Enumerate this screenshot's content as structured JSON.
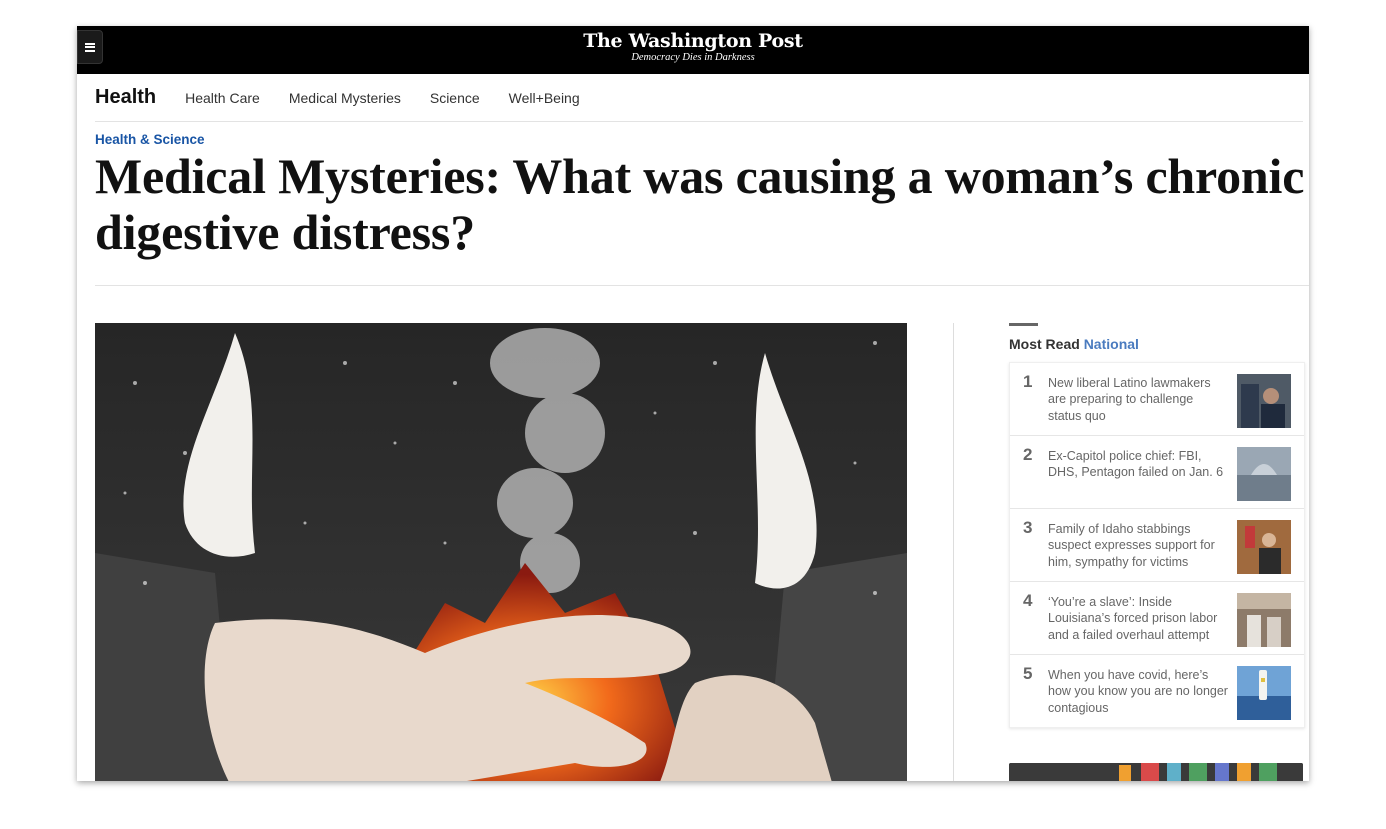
{
  "masthead": {
    "logo": "The Washington Post",
    "tagline": "Democracy Dies in Darkness"
  },
  "subnav": {
    "section": "Health",
    "links": [
      "Health Care",
      "Medical Mysteries",
      "Science",
      "Well+Being"
    ]
  },
  "article": {
    "kicker": "Health & Science",
    "headline": "Medical Mysteries: What was causing a woman’s chronic digestive distress?"
  },
  "most_read": {
    "title": "Most Read",
    "title_accent": "National",
    "items": [
      {
        "rank": "1",
        "text": "New liberal Latino lawmakers are preparing to challenge status quo"
      },
      {
        "rank": "2",
        "text": "Ex-Capitol police chief: FBI, DHS, Pentagon failed on Jan. 6"
      },
      {
        "rank": "3",
        "text": "Family of Idaho stabbings suspect expresses support for him, sympathy for victims"
      },
      {
        "rank": "4",
        "text": "‘You’re a slave’: Inside Louisiana’s forced prison labor and a failed overhaul attempt"
      },
      {
        "rank": "5",
        "text": "When you have covid, here’s how you know you are no longer contagious"
      }
    ]
  },
  "colors": {
    "masthead_bg": "#000000",
    "kicker": "#1955a5",
    "accent": "#4a7bbf"
  }
}
